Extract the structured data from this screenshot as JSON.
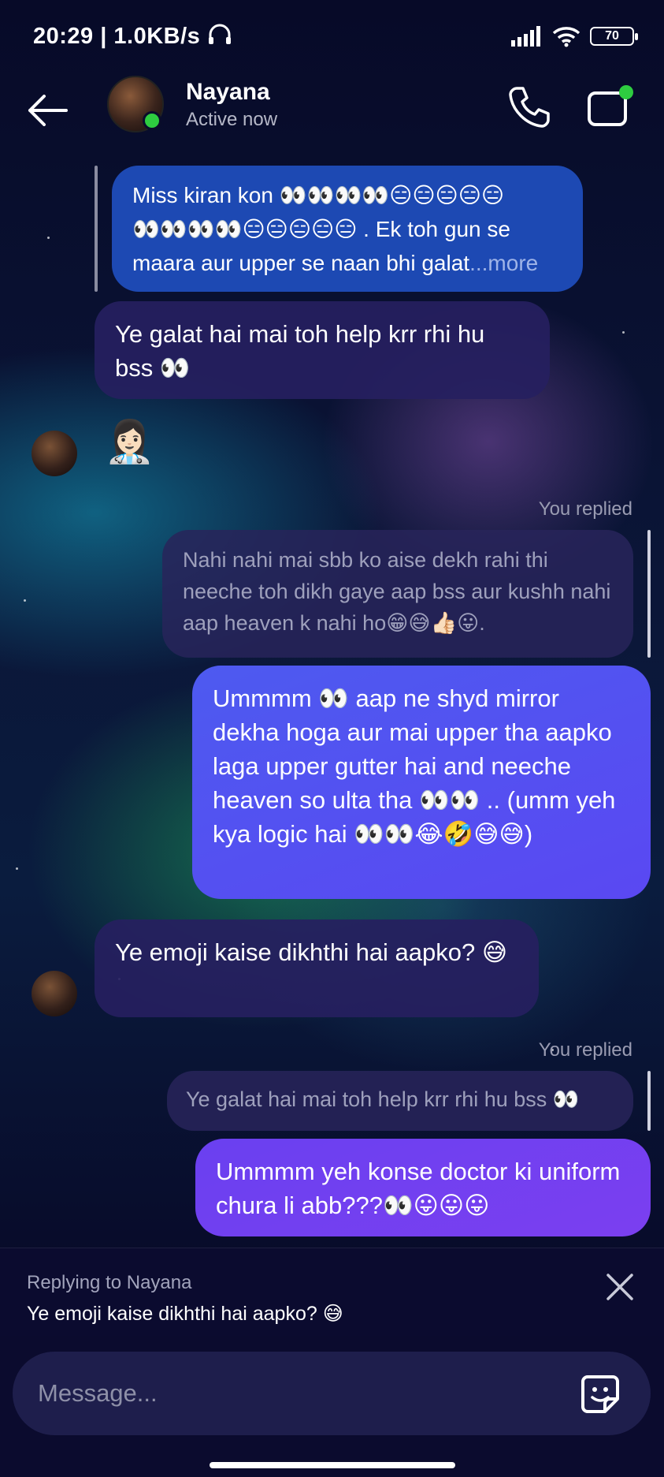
{
  "status_bar": {
    "time_speed": "20:29 | 1.0KB/s",
    "battery": "70"
  },
  "header": {
    "contact_name": "Nayana",
    "contact_status": "Active now"
  },
  "messages": {
    "m1_line1": "Miss kiran kon 👀👀👀👀😑😑😑😑😑",
    "m1_line2": "👀👀👀👀😑😑😑😑😑 .  Ek toh gun se",
    "m1_line3": "maara aur upper se naan bhi galat",
    "m1_more": "...more",
    "m2": "Ye galat hai mai toh help krr rhi hu bss 👀",
    "m3_emoji": "👩🏻‍⚕️",
    "you_replied_1": "You replied",
    "m4_quote": "Nahi nahi mai sbb ko aise dekh rahi thi neeche toh dikh gaye aap bss aur kushh nahi aap heaven k nahi ho😁😅👍🏻😛.",
    "m5": "Ummmm 👀 aap ne shyd mirror dekha hoga aur mai upper tha aapko laga upper gutter hai and neeche heaven so ulta tha 👀👀 .. (umm yeh kya logic hai 👀👀😂🤣😅😅)",
    "m6": "Ye emoji kaise dikhthi hai aapko? 😅",
    "you_replied_2": "You replied",
    "m7_quote": "Ye galat hai mai toh help krr rhi hu bss 👀",
    "m8": "Ummmm yeh konse doctor ki uniform chura li abb???👀😛😛😛"
  },
  "reply_bar": {
    "replying_to": "Replying to Nayana",
    "replying_text": "Ye emoji kaise dikhthi hai aapko? 😅"
  },
  "composer": {
    "placeholder": "Message..."
  },
  "icons": {
    "back": "arrow-left-icon",
    "call": "phone-icon",
    "video": "video-camera-icon",
    "close": "close-icon",
    "sticker": "sticker-icon"
  },
  "colors": {
    "online": "#2ecc40",
    "sent_bubble": "#4d5af0",
    "sent_bubble_alt": "#7b3ff0",
    "received_bubble": "#262060"
  }
}
